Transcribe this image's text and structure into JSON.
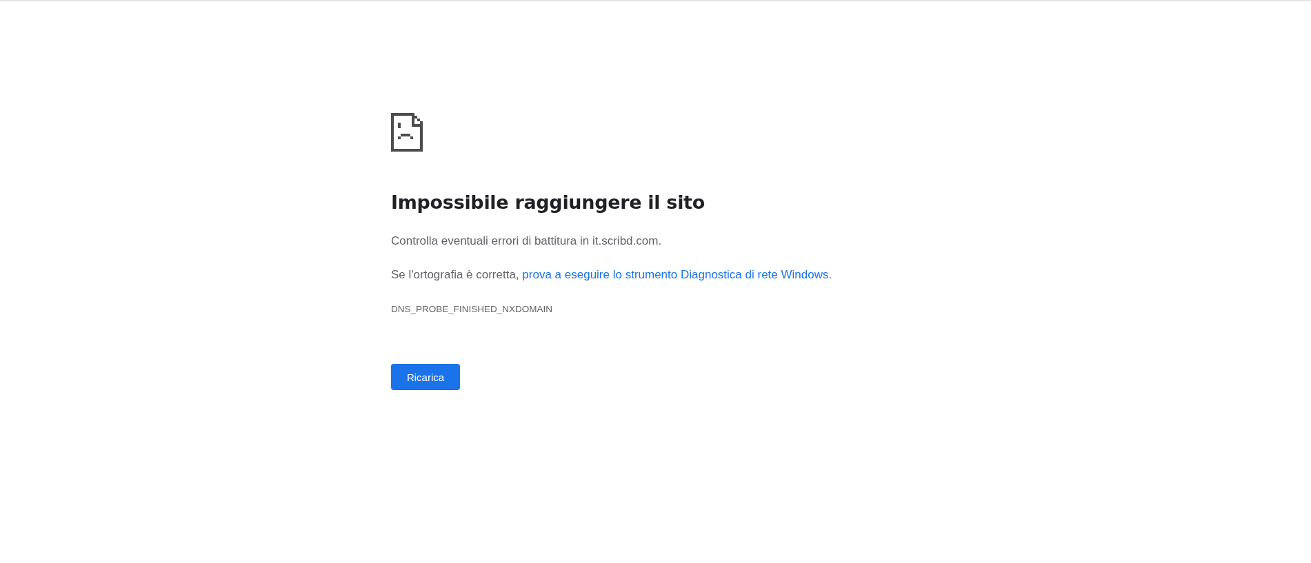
{
  "error": {
    "heading": "Impossibile raggiungere il sito",
    "check_text": "Controlla eventuali errori di battitura in it.scribd.com.",
    "suggestion_prefix": "Se l'ortografia è corretta, ",
    "suggestion_link": "prova a eseguire lo strumento Diagnostica di rete Windows",
    "suggestion_suffix": ".",
    "code": "DNS_PROBE_FINISHED_NXDOMAIN"
  },
  "buttons": [
    {
      "label": "Ricarica"
    }
  ]
}
